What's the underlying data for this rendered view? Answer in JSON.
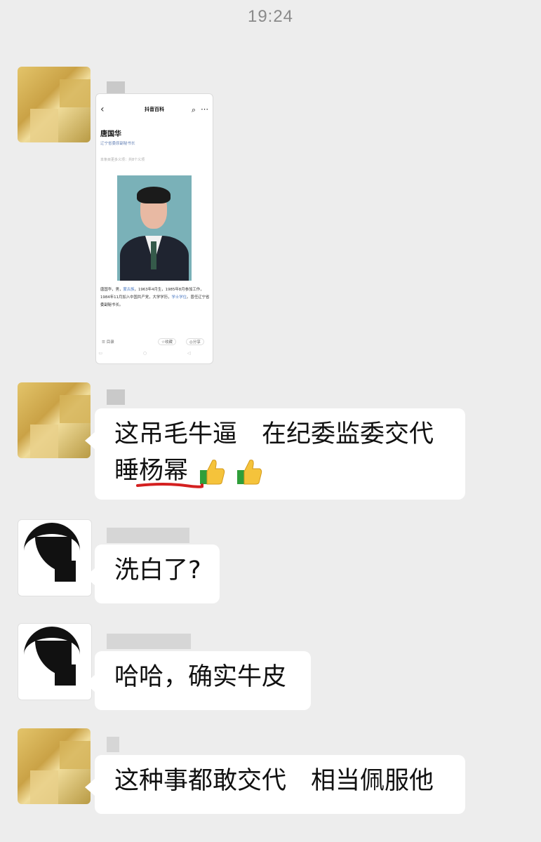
{
  "time": "19:24",
  "card": {
    "app_title": "抖音百科",
    "person_name": "唐国华",
    "person_role": "辽宁省委原副秘书长",
    "meta": "本条目更多义项：共8个义项",
    "desc_parts": [
      "唐国华，男，",
      "蒙古族",
      "，1963年4月生，1985年8月参加工作，1984年11月加入中国共产党，大学学历，",
      "学士学位",
      "。曾任辽宁省委副秘书长。"
    ],
    "bottom_contents": "目录",
    "bottom_favorite": "收藏",
    "bottom_share": "分享"
  },
  "messages": [
    {
      "line1": "这吊毛牛逼　在纪委监委交代",
      "line2_prefix": "睡",
      "line2_underlined": "杨幂",
      "emoji": "thumbs-up"
    },
    {
      "text": "洗白了?"
    },
    {
      "text": "哈哈，确实牛皮"
    },
    {
      "text": "这种事都敢交代　相当佩服他"
    }
  ],
  "colors": {
    "background": "#ededed",
    "bubble": "#ffffff",
    "underline": "#d42020",
    "time": "#8a8a8a"
  }
}
